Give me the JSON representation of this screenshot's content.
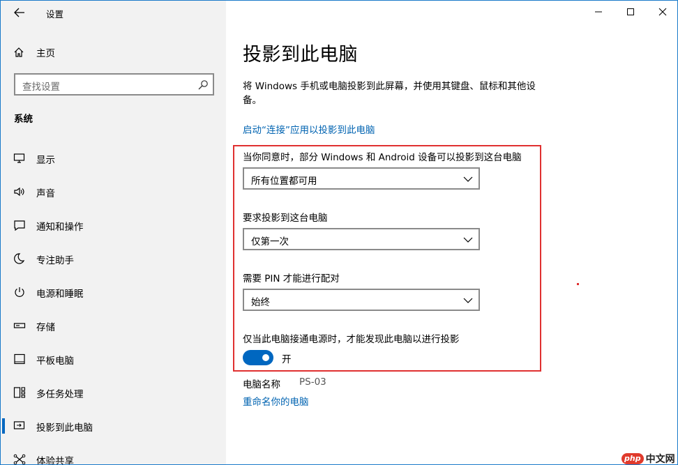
{
  "window": {
    "title": "设置",
    "back_icon": "arrow-left-icon",
    "controls": [
      "minimize-icon",
      "maximize-icon",
      "close-icon"
    ]
  },
  "sidebar": {
    "home_label": "主页",
    "search_placeholder": "查找设置",
    "section": "系统",
    "items": [
      {
        "label": "显示",
        "icon": "monitor-icon"
      },
      {
        "label": "声音",
        "icon": "speaker-icon"
      },
      {
        "label": "通知和操作",
        "icon": "notification-icon"
      },
      {
        "label": "专注助手",
        "icon": "moon-icon"
      },
      {
        "label": "电源和睡眠",
        "icon": "power-icon"
      },
      {
        "label": "存储",
        "icon": "storage-icon"
      },
      {
        "label": "平板电脑",
        "icon": "tablet-icon"
      },
      {
        "label": "多任务处理",
        "icon": "multitask-icon"
      },
      {
        "label": "投影到此电脑",
        "icon": "project-icon",
        "active": true
      },
      {
        "label": "体验共享",
        "icon": "share-icon"
      }
    ]
  },
  "main": {
    "title": "投影到此电脑",
    "description": "将 Windows 手机或电脑投影到此屏幕，并使用其键盘、鼠标和其他设备。",
    "launch_link": "启动“连接”应用以投影到此电脑",
    "availability_label": "当你同意时，部分 Windows 和 Android 设备可以投影到这台电脑",
    "availability_value": "所有位置都可用",
    "ask_label": "要求投影到这台电脑",
    "ask_value": "仅第一次",
    "pin_label": "需要 PIN 才能进行配对",
    "pin_value": "始终",
    "power_label": "仅当此电脑接通电源时，才能发现此电脑以进行投影",
    "power_toggle_state": "开",
    "pc_name_key": "电脑名称",
    "pc_name_value": "PS-03",
    "rename_link": "重命名你的电脑"
  },
  "watermark": {
    "logo": "php",
    "text": "中文网"
  },
  "colors": {
    "accent": "#0067c0",
    "link": "#0063b1",
    "highlight": "#e03030",
    "sidebar_bg": "#f2f2f2"
  }
}
